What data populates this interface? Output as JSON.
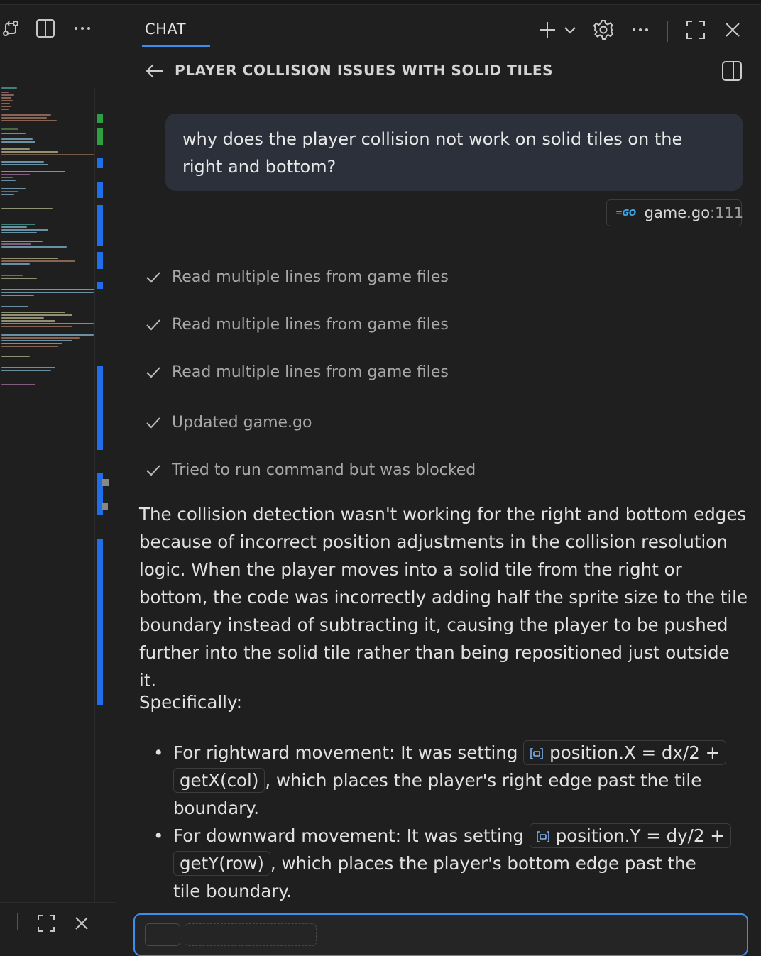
{
  "chat": {
    "tab_label": "CHAT",
    "conversation_title": "PLAYER COLLISION ISSUES WITH SOLID TILES",
    "user_message": "why does the player collision not work on solid tiles on the right and bottom?",
    "file_reference": {
      "language_badge": "=GO",
      "file_name": "game.go",
      "line_suffix": ":111"
    },
    "steps": [
      {
        "label": "Read multiple lines from game files",
        "status": "done"
      },
      {
        "label": "Read multiple lines from game files",
        "status": "done"
      },
      {
        "label": "Read multiple lines from game files",
        "status": "done"
      },
      {
        "label": "Updated game.go",
        "status": "done"
      },
      {
        "label": "Tried to run command but was blocked",
        "status": "done"
      }
    ],
    "answer_paragraph": "The collision detection wasn't working for the right and bottom edges because of incorrect position adjustments in the collision resolution logic. When the player moves into a solid tile from the right or bottom, the code was incorrectly adding half the sprite size to the tile boundary instead of subtracting it, causing the player to be pushed further into the solid tile rather than being repositioned just outside it.",
    "specifically_label": "Specifically:",
    "bullets": [
      {
        "prefix": "For rightward movement: It was setting ",
        "code": "position.X = dx/2 + getX(col)",
        "suffix": ", which places the player's right edge past the tile boundary."
      },
      {
        "prefix": "For downward movement: It was setting ",
        "code": "position.Y = dy/2 + getY(row)",
        "suffix": ", which places the player's bottom edge past the tile boundary."
      }
    ]
  },
  "header_icons": [
    "new-chat-icon",
    "chevron-down-icon",
    "settings-gear-icon",
    "more-icon",
    "maximize-icon",
    "close-icon"
  ],
  "editor_icons": [
    "source-control-icon",
    "split-editor-icon",
    "more-icon",
    "fullscreen-icon",
    "close-icon"
  ],
  "colors": {
    "accent": "#3b8eea",
    "user_bubble": "#2b303b",
    "go_badge": "#3fa8e8"
  }
}
